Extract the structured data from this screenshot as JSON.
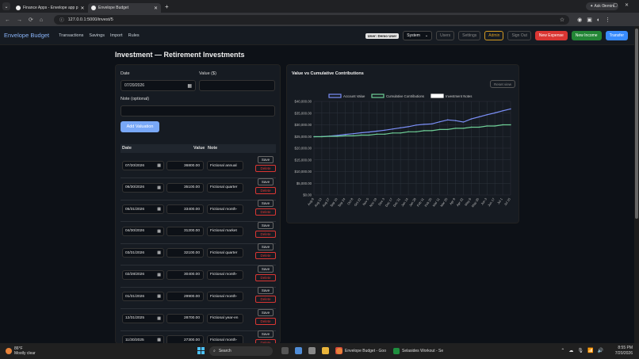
{
  "browser": {
    "tabs": [
      {
        "title": "Finance Apps - Envelope app p"
      },
      {
        "title": "Envelope Budget"
      }
    ],
    "url": "127.0.0.1:5000/invest/5",
    "ask_gemini": "Ask Gemini"
  },
  "nav": {
    "brand": "Envelope Budget",
    "links": [
      "Transactions",
      "Savings",
      "Import",
      "Rules"
    ],
    "user": "User: Demo User",
    "theme": "System",
    "buttons": {
      "users": "Users",
      "settings": "Settings",
      "admin": "Admin",
      "signout": "Sign Out",
      "new_expense": "New Expense",
      "new_income": "New Income",
      "transfer": "Transfer"
    }
  },
  "page": {
    "title": "Investment — Retirement Investments"
  },
  "form": {
    "date_label": "Date",
    "date_value": "07/20/2026",
    "value_label": "Value ($)",
    "value_value": "",
    "note_label": "Note (optional)",
    "note_value": "",
    "add_button": "Add Valuation"
  },
  "table": {
    "headers": {
      "date": "Date",
      "value": "Value",
      "note": "Note"
    },
    "save_label": "Save",
    "delete_label": "Delete",
    "rows": [
      {
        "date": "07/20/2026",
        "value": "36800.00",
        "note": "Fictional annual"
      },
      {
        "date": "06/30/2026",
        "value": "35100.00",
        "note": "Fictional quarter"
      },
      {
        "date": "05/31/2026",
        "value": "33400.00",
        "note": "Fictional month-"
      },
      {
        "date": "04/30/2026",
        "value": "31200.00",
        "note": "Fictional market"
      },
      {
        "date": "03/31/2026",
        "value": "32100.00",
        "note": "Fictional quarter"
      },
      {
        "date": "02/28/2026",
        "value": "30400.00",
        "note": "Fictional month-"
      },
      {
        "date": "01/31/2026",
        "value": "29900.00",
        "note": "Fictional month-"
      },
      {
        "date": "12/31/2025",
        "value": "28700.00",
        "note": "Fictional year-en"
      },
      {
        "date": "11/30/2025",
        "value": "27300.00",
        "note": "Fictional month-"
      }
    ]
  },
  "chart_panel": {
    "title": "Value vs Cumulative Contributions",
    "reset": "Reset view"
  },
  "chart_data": {
    "type": "line",
    "title": "Value vs Cumulative Contributions",
    "legend": [
      "Account Value",
      "Cumulative Contributions",
      "Investment Notes"
    ],
    "legend_position": "top",
    "yticks": [
      "$40,000.00",
      "$35,000.00",
      "$30,000.00",
      "$25,000.00",
      "$20,000.00",
      "$15,000.00",
      "$10,000.00",
      "$5,000.00",
      "$0.00"
    ],
    "ylim": [
      0,
      40000
    ],
    "categories": [
      "Aug 6",
      "Aug 13",
      "Aug 27",
      "Sep 10",
      "Sep 24",
      "Oct 8",
      "Oct 22",
      "Nov 5",
      "Nov 19",
      "Dec 3",
      "Dec 17",
      "Dec 31",
      "Jan 14",
      "Jan 28",
      "Feb 11",
      "Feb 25",
      "Mar 11",
      "Mar 25",
      "Apr 8",
      "Apr 22",
      "May 6",
      "May 20",
      "Jun 3",
      "Jun 17",
      "Jul 1",
      "Jul 15"
    ],
    "series": [
      {
        "name": "Account Value",
        "color": "#7b8ff7",
        "values": [
          24900,
          25000,
          25200,
          25500,
          25900,
          26200,
          26600,
          26900,
          27300,
          27700,
          28200,
          28700,
          29200,
          29900,
          30200,
          30400,
          31300,
          32100,
          31800,
          31200,
          32500,
          33400,
          34300,
          35100,
          36000,
          36800
        ]
      },
      {
        "name": "Cumulative Contributions",
        "color": "#6fcf97",
        "values": [
          24900,
          24900,
          25100,
          25100,
          25300,
          25300,
          25600,
          25600,
          26000,
          26000,
          26500,
          26500,
          27000,
          27000,
          27500,
          27500,
          28000,
          28000,
          28500,
          28500,
          29000,
          29000,
          29500,
          29500,
          30000,
          30000
        ]
      }
    ],
    "grid": true
  },
  "taskbar": {
    "weather_temp": "86°F",
    "weather_desc": "Mostly clear",
    "search": "Search",
    "apps": [
      "Envelope Budget - Goo",
      "Selasides Workout - Se"
    ],
    "time": "8:55 PM",
    "date": "7/20/2026"
  }
}
